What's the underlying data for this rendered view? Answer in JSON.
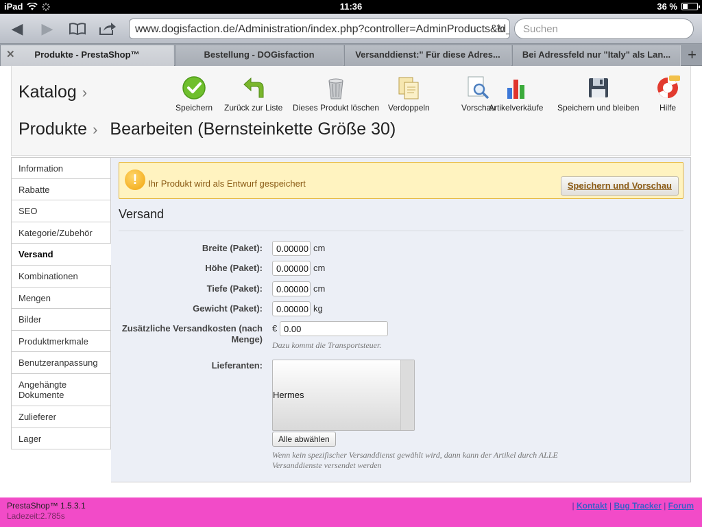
{
  "status": {
    "device": "iPad",
    "time": "11:36",
    "battery": "36 %",
    "battery_level": 0.36
  },
  "browser": {
    "url": "www.dogisfaction.de/Administration/index.php?controller=AdminProducts&id_p",
    "search_placeholder": "Suchen",
    "tabs": [
      {
        "label": "Produkte - PrestaShop™"
      },
      {
        "label": "Bestellung - DOGisfaction"
      },
      {
        "label": "Versanddienst:\" Für diese Adres..."
      },
      {
        "label": "Bei Adressfeld nur \"Italy\" als Lan..."
      }
    ]
  },
  "header": {
    "crumb1": "Katalog",
    "crumb2": "Produkte",
    "title": "Bearbeiten (Bernsteinkette Größe 30)",
    "toolbar": [
      {
        "label": "Speichern",
        "icon": "check-circle-icon"
      },
      {
        "label": "Zurück zur Liste",
        "icon": "back-arrow-icon"
      },
      {
        "label": "Dieses Produkt löschen",
        "icon": "trash-icon"
      },
      {
        "label": "Verdoppeln",
        "icon": "duplicate-icon"
      },
      {
        "label": "Vorschau",
        "icon": "preview-icon"
      },
      {
        "label": "Artikelverkäufe",
        "icon": "bar-chart-icon"
      },
      {
        "label": "Speichern und bleiben",
        "icon": "floppy-icon"
      },
      {
        "label": "Hilfe",
        "icon": "lifebuoy-icon"
      }
    ]
  },
  "sidebar": {
    "items": [
      {
        "label": "Information"
      },
      {
        "label": "Rabatte"
      },
      {
        "label": "SEO"
      },
      {
        "label": "Kategorie/Zubehör"
      },
      {
        "label": "Versand"
      },
      {
        "label": "Kombinationen"
      },
      {
        "label": "Mengen"
      },
      {
        "label": "Bilder"
      },
      {
        "label": "Produktmerkmale"
      },
      {
        "label": "Benutzeranpassung"
      },
      {
        "label": "Angehängte Dokumente"
      },
      {
        "label": "Zulieferer"
      },
      {
        "label": "Lager"
      }
    ]
  },
  "warning": {
    "text": "Ihr Produkt wird als Entwurf gespeichert",
    "button": "Speichern und Vorschau"
  },
  "form": {
    "section": "Versand",
    "width_label": "Breite (Paket):",
    "width_value": "0.00000",
    "width_unit": "cm",
    "height_label": "Höhe (Paket):",
    "height_value": "0.00000",
    "height_unit": "cm",
    "depth_label": "Tiefe (Paket):",
    "depth_value": "0.00000",
    "depth_unit": "cm",
    "weight_label": "Gewicht (Paket):",
    "weight_value": "0.00000",
    "weight_unit": "kg",
    "extra_label": "Zusätzliche Versandkosten (nach Menge)",
    "extra_currency": "€",
    "extra_value": "0.00",
    "extra_hint": "Dazu kommt die Transportsteuer.",
    "carriers_label": "Lieferanten:",
    "carrier_option": "Hermes",
    "deselect_button": "Alle abwählen",
    "carriers_hint": "Wenn kein spezifischer Versanddienst gewählt wird, dann kann der Artikel durch ALLE Versanddienste versendet werden"
  },
  "footer": {
    "version": "PrestaShop™ 1.5.3.1",
    "load_time": "Ladezeit:2.785s",
    "sep": "|",
    "links": [
      "Kontakt",
      "Bug Tracker",
      "Forum"
    ]
  }
}
